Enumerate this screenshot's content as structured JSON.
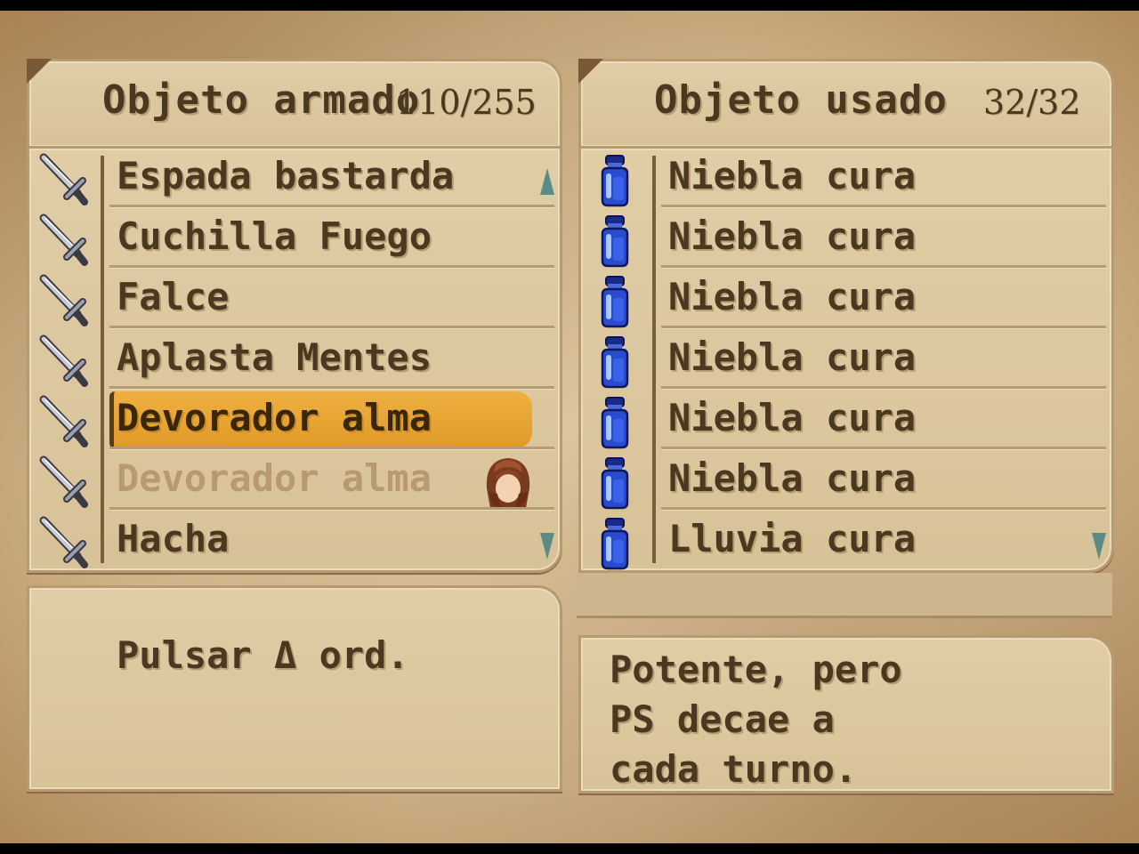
{
  "left_panel": {
    "title": "Objeto armado",
    "count": "110/255",
    "items": [
      {
        "label": "Espada bastarda",
        "icon": "sword-icon",
        "state": "normal"
      },
      {
        "label": "Cuchilla Fuego",
        "icon": "sword-icon",
        "state": "normal"
      },
      {
        "label": "Falce",
        "icon": "sword-icon",
        "state": "normal"
      },
      {
        "label": "Aplasta Mentes",
        "icon": "sword-icon",
        "state": "normal"
      },
      {
        "label": "Devorador alma",
        "icon": "sword-icon",
        "state": "selected"
      },
      {
        "label": "Devorador alma",
        "icon": "sword-icon",
        "state": "equipped-dim"
      },
      {
        "label": "Hacha",
        "icon": "sword-icon",
        "state": "normal"
      }
    ]
  },
  "right_panel": {
    "title": "Objeto usado",
    "count": "32/32",
    "items": [
      {
        "label": "Niebla cura",
        "icon": "potion-bottle-icon"
      },
      {
        "label": "Niebla cura",
        "icon": "potion-bottle-icon"
      },
      {
        "label": "Niebla cura",
        "icon": "potion-bottle-icon"
      },
      {
        "label": "Niebla cura",
        "icon": "potion-bottle-icon"
      },
      {
        "label": "Niebla cura",
        "icon": "potion-bottle-icon"
      },
      {
        "label": "Niebla cura",
        "icon": "potion-bottle-icon"
      },
      {
        "label": "Lluvia cura",
        "icon": "potion-bottle-icon"
      }
    ]
  },
  "hint": {
    "text": "Pulsar Δ ord."
  },
  "description": {
    "lines": [
      "Potente, pero",
      "PS decae a",
      "cada turno."
    ]
  },
  "colors": {
    "text": "#4a3820",
    "highlight": "#e8a838",
    "parchment": "#dcc8a0"
  }
}
